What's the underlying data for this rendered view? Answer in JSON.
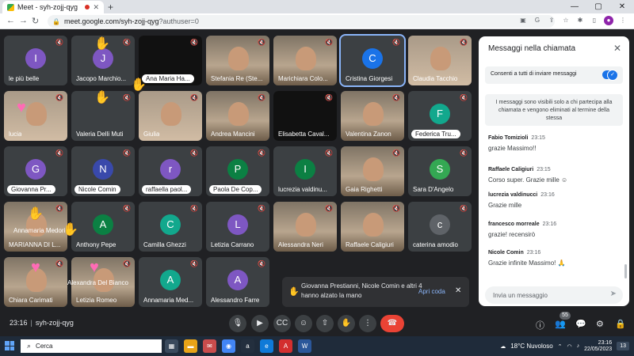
{
  "browser": {
    "tab_title": "Meet - syh-zojj-qyg",
    "tab_close": "✕",
    "new_tab": "+",
    "url_host": "meet.google.com/syh-zojj-qyg",
    "url_query": "?authuser=0",
    "win_min": "—",
    "win_max": "▢",
    "win_close": "✕"
  },
  "meeting": {
    "time": "23:16",
    "code": "syh-zojj-qyg",
    "participants_count": "55"
  },
  "colors": {
    "accent": "#8ab4f8",
    "end_call": "#ea4335",
    "tile_bg": "#3c4043"
  },
  "tiles": [
    {
      "name": "le più belle",
      "initial": "I",
      "color": "#7e57c2"
    },
    {
      "name": "Jacopo Marchio...",
      "initial": "J",
      "color": "#7e57c2"
    },
    {
      "name": "Ana Maria Ha...",
      "initial": "",
      "color": ""
    },
    {
      "name": "Stefania Re (Ste...",
      "initial": "",
      "color": ""
    },
    {
      "name": "Marichiara Colo...",
      "initial": "",
      "color": ""
    },
    {
      "name": "Cristina Giorgesi",
      "initial": "C",
      "color": "#1a73e8"
    },
    {
      "name": "Claudia Tacchio",
      "initial": "",
      "color": ""
    },
    {
      "name": "lucia",
      "initial": "",
      "color": ""
    },
    {
      "name": "Valeria Delli Muti",
      "initial": "",
      "color": ""
    },
    {
      "name": "Giulia",
      "initial": "",
      "color": ""
    },
    {
      "name": "Andrea Mancini",
      "initial": "",
      "color": ""
    },
    {
      "name": "Elisabetta Caval...",
      "initial": "",
      "color": ""
    },
    {
      "name": "Valentina Zanon",
      "initial": "",
      "color": ""
    },
    {
      "name": "Federica Tru...",
      "initial": "F",
      "color": "#12a88d"
    },
    {
      "name": "Giovanna Pr...",
      "initial": "G",
      "color": "#7e57c2"
    },
    {
      "name": "Nicole Comin",
      "initial": "N",
      "color": "#3949ab"
    },
    {
      "name": "raffaella paol...",
      "initial": "r",
      "color": "#7e57c2"
    },
    {
      "name": "Paola De Cop...",
      "initial": "P",
      "color": "#0b8043"
    },
    {
      "name": "lucrezia valdinu...",
      "initial": "I",
      "color": "#0b8043"
    },
    {
      "name": "Gaia Righetti",
      "initial": "",
      "color": ""
    },
    {
      "name": "Sara D'Angelo",
      "initial": "S",
      "color": "#34a853"
    },
    {
      "name": "MARIANNA DI L...",
      "initial": "",
      "color": ""
    },
    {
      "name": "Anthony Pepe",
      "initial": "A",
      "color": "#0b8043"
    },
    {
      "name": "Camilla Ghezzi",
      "initial": "C",
      "color": "#12a88d"
    },
    {
      "name": "Letizia Carrano",
      "initial": "L",
      "color": "#7e57c2"
    },
    {
      "name": "Alessandra Neri",
      "initial": "",
      "color": ""
    },
    {
      "name": "Raffaele Caligiuri",
      "initial": "",
      "color": ""
    },
    {
      "name": "caterina amodio",
      "initial": "c",
      "color": "#5f6368"
    },
    {
      "name": "Chiara Carimati",
      "initial": "",
      "color": ""
    },
    {
      "name": "Letizia Romeo",
      "initial": "",
      "color": ""
    },
    {
      "name": "Annamaria Med...",
      "initial": "A",
      "color": "#12a88d"
    },
    {
      "name": "Alessandro Farre",
      "initial": "A",
      "color": "#7e57c2"
    }
  ],
  "overlays": {
    "annamaria_label": "Annamaria Medori",
    "alexandra_label": "Alexandra Del Bianco"
  },
  "notification": {
    "text": "Giovanna Prestianni, Nicole Comin e altri 4 hanno alzato la mano",
    "action": "Apri coda",
    "close": "✕"
  },
  "chat": {
    "title": "Messaggi nella chiamata",
    "close": "✕",
    "toggle_label": "Consenti a tutti di inviare messaggi",
    "info": "I messaggi sono visibili solo a chi partecipa alla chiamata e vengono eliminati al termine della stessa",
    "messages": [
      {
        "author": "Fabio Tomizioli",
        "time": "23:15",
        "text": "grazie Massimo!!"
      },
      {
        "author": "Raffaele Caligiuri",
        "time": "23:15",
        "text": "Corso super. Grazie mille ☺"
      },
      {
        "author": "lucrezia valdinucci",
        "time": "23:16",
        "text": "Grazie mille"
      },
      {
        "author": "francesco morreale",
        "time": "23:16",
        "text": "grazie! recensirò"
      },
      {
        "author": "Nicole Comin",
        "time": "23:16",
        "text": "Grazie infinite Massimo! 🙏"
      }
    ],
    "input_placeholder": "Invia un messaggio"
  },
  "taskbar": {
    "search_placeholder": "Cerca",
    "weather": "18°C Nuvoloso",
    "time": "23:16",
    "date": "22/05/2023",
    "notif_count": "13"
  }
}
